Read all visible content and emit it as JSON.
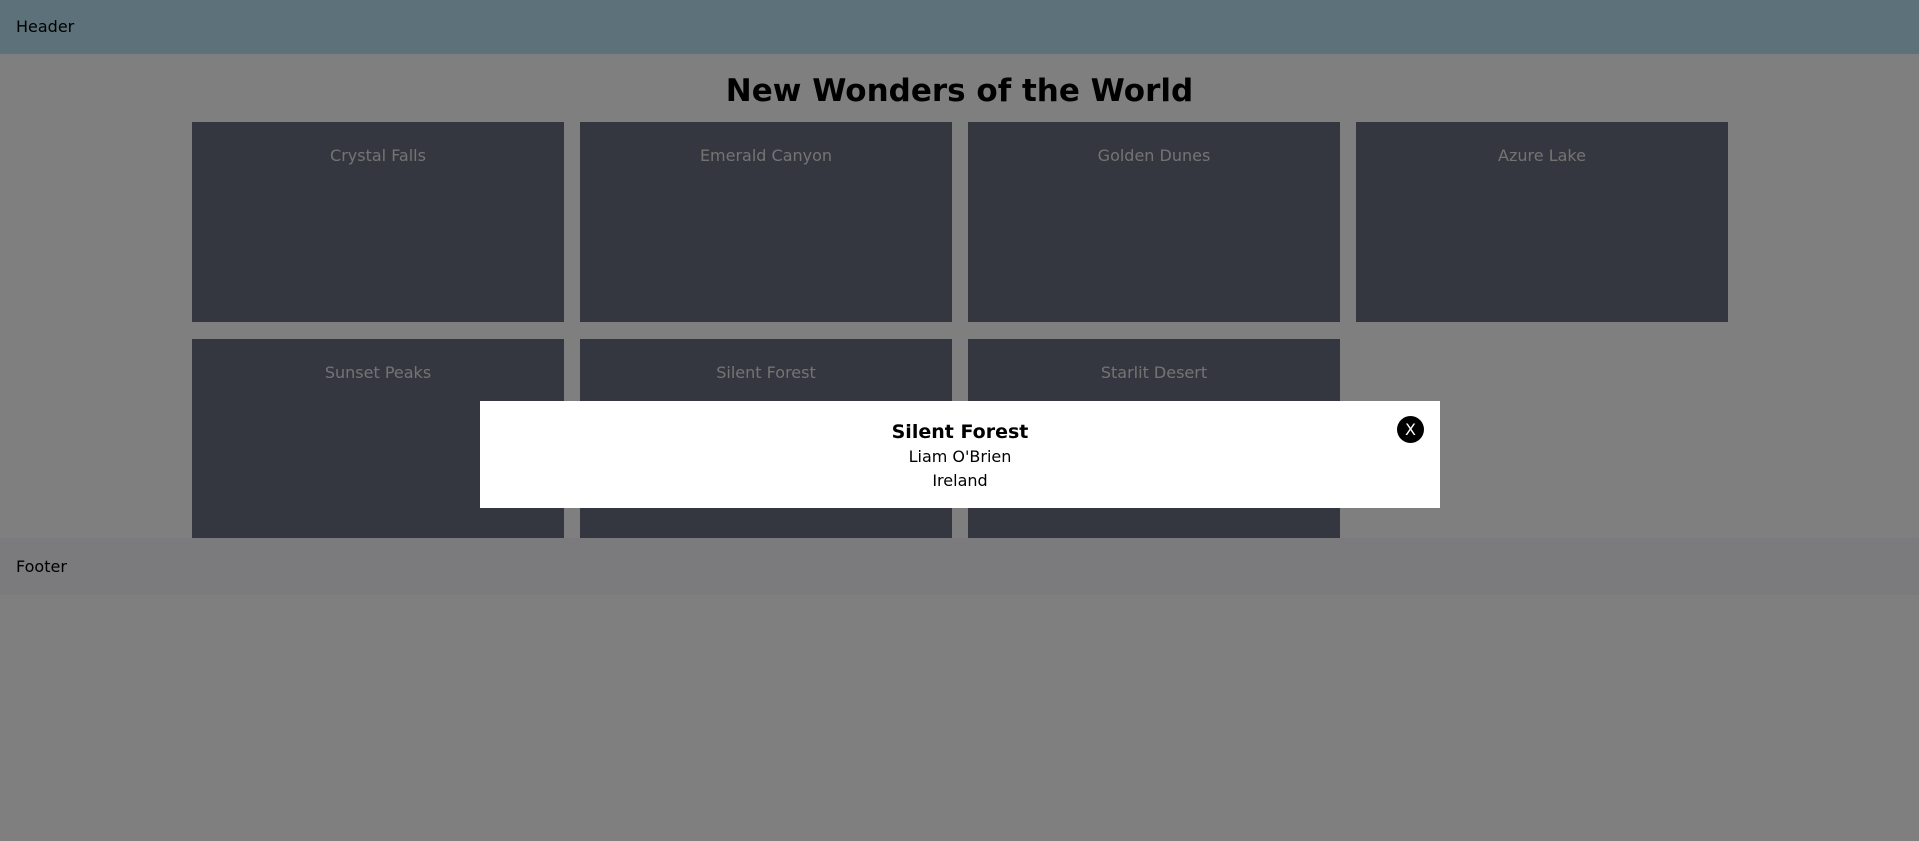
{
  "header": {
    "label": "Header"
  },
  "page": {
    "title": "New Wonders of the World"
  },
  "cards": [
    {
      "title": "Crystal Falls"
    },
    {
      "title": "Emerald Canyon"
    },
    {
      "title": "Golden Dunes"
    },
    {
      "title": "Azure Lake"
    },
    {
      "title": "Sunset Peaks"
    },
    {
      "title": "Silent Forest"
    },
    {
      "title": "Starlit Desert"
    }
  ],
  "footer": {
    "label": "Footer"
  },
  "modal": {
    "title": "Silent Forest",
    "author": "Liam O'Brien",
    "country": "Ireland",
    "close_label": "X"
  },
  "colors": {
    "header_bg": "#b9e2f3",
    "card_bg": "#6b6f80",
    "footer_bg": "#f7f5fb",
    "overlay": "rgba(0,0,0,0.5)"
  }
}
